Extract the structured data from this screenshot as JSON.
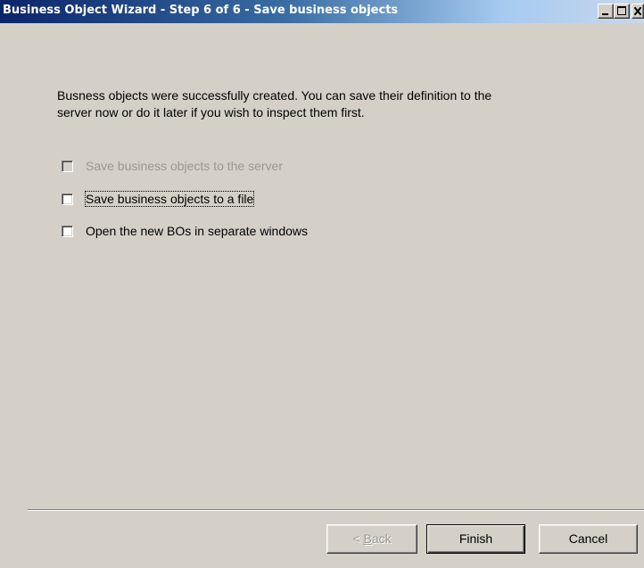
{
  "window": {
    "title": "Business Object Wizard - Step 6 of 6 - Save business objects"
  },
  "message": {
    "line1": "Busness objects were successfully created. You can save their definition to the",
    "line2": "server now or do it later if you wish to inspect them first."
  },
  "options": [
    {
      "label": "Save business objects to the server",
      "checked": false,
      "enabled": false
    },
    {
      "label": "Save business objects to a file",
      "checked": false,
      "enabled": true
    },
    {
      "label": "Open the new BOs in separate windows",
      "checked": false,
      "enabled": true
    }
  ],
  "buttons": {
    "back_prefix": "< ",
    "back_mnemonic": "B",
    "back_rest": "ack",
    "finish": "Finish",
    "cancel": "Cancel"
  },
  "colors": {
    "titlebar_start": "#0a246a",
    "titlebar_end": "#a6caf0",
    "face": "#d4d0c8",
    "disabled_text": "#9b9890"
  }
}
